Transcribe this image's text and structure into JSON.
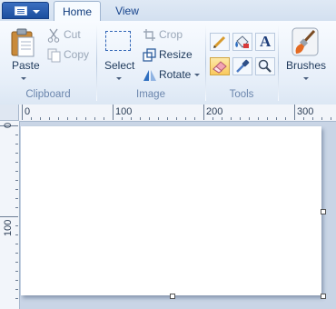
{
  "tabs": [
    {
      "label": "Home"
    },
    {
      "label": "View"
    }
  ],
  "clipboard": {
    "paste_label": "Paste",
    "cut_label": "Cut",
    "copy_label": "Copy",
    "group_label": "Clipboard"
  },
  "image": {
    "select_label": "Select",
    "crop_label": "Crop",
    "resize_label": "Resize",
    "rotate_label": "Rotate",
    "group_label": "Image"
  },
  "tools": {
    "group_label": "Tools",
    "items": [
      "pencil-icon",
      "fill-icon",
      "text-icon",
      "eraser-icon",
      "color-picker-icon",
      "magnifier-icon"
    ],
    "text_glyph": "A",
    "active_tool": "eraser"
  },
  "brushes": {
    "label": "Brushes"
  },
  "ruler": {
    "top_labels": [
      "0",
      "100",
      "200",
      "300"
    ],
    "left_labels": [
      "0",
      "100"
    ]
  },
  "colors": {
    "accent": "#1c4e9e",
    "active_tool": "#f9c95e",
    "canvas": "#ffffff",
    "workspace": "#c9d5e6"
  }
}
